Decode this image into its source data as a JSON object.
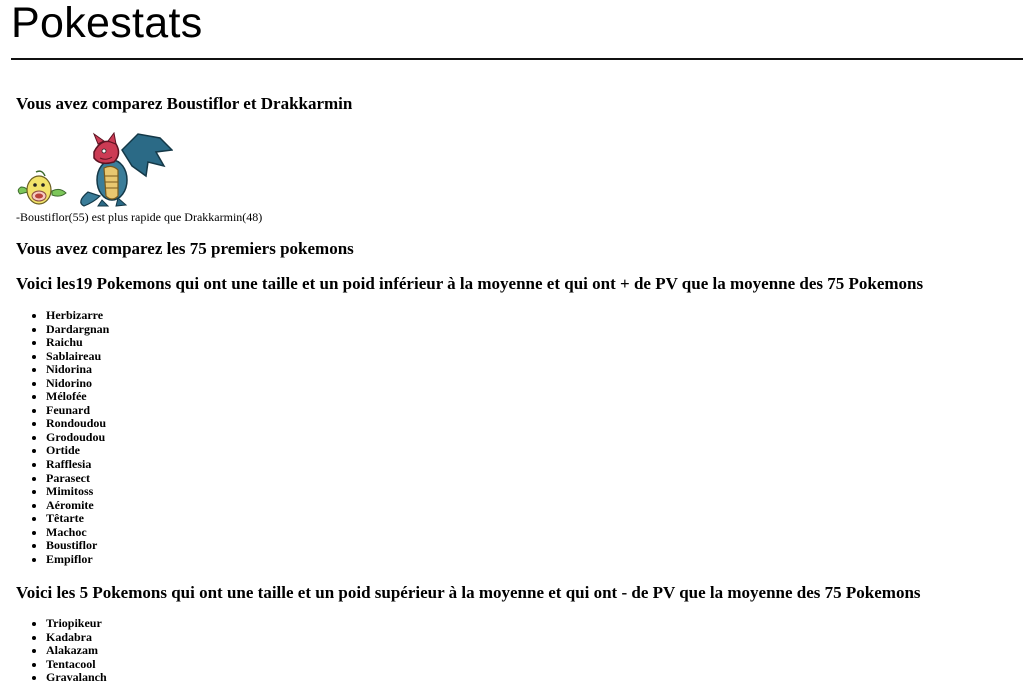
{
  "site": {
    "title": "Pokestats"
  },
  "comparison": {
    "heading": "Vous avez comparez Boustiflor et Drakkarmin",
    "result": "-Boustiflor(55) est plus rapide que Drakkarmin(48)"
  },
  "summary": {
    "heading": "Vous avez comparez les 75 premiers pokemons"
  },
  "list1": {
    "heading": "Voici les19 Pokemons qui ont une taille et un poid inférieur à la moyenne et qui ont + de PV que la moyenne des 75 Pokemons",
    "items": [
      "Herbizarre",
      "Dardargnan",
      "Raichu",
      "Sablaireau",
      "Nidorina",
      "Nidorino",
      "Mélofée",
      "Feunard",
      "Rondoudou",
      "Grodoudou",
      "Ortide",
      "Rafflesia",
      "Parasect",
      "Mimitoss",
      "Aéromite",
      "Têtarte",
      "Machoc",
      "Boustiflor",
      "Empiflor"
    ]
  },
  "list2": {
    "heading": "Voici les 5 Pokemons qui ont une taille et un poid supérieur à la moyenne et qui ont - de PV que la moyenne des 75 Pokemons",
    "items": [
      "Triopikeur",
      "Kadabra",
      "Alakazam",
      "Tentacool",
      "Gravalanch"
    ]
  }
}
